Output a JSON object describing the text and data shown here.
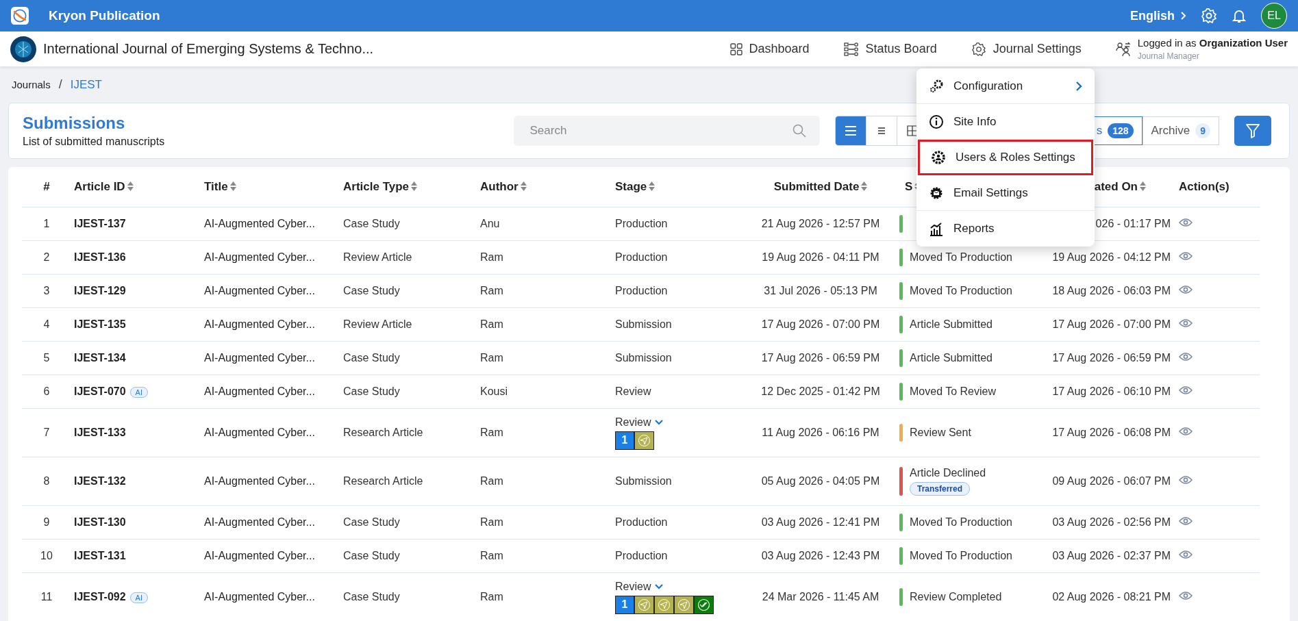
{
  "app_bar": {
    "title": "Kryon Publication",
    "language": "English",
    "avatar": "EL"
  },
  "journal_bar": {
    "title": "International Journal of Emerging Systems & Techno...",
    "nav": [
      "Dashboard",
      "Status Board",
      "Journal Settings"
    ],
    "user": "Logged in as **Organization User**",
    "role": "Journal Manager"
  },
  "breadcrumb": [
    {
      "label": "Journals",
      "selected": false
    },
    {
      "separator": "/",
      "label": "IJEST",
      "selected": true
    }
  ],
  "header": {
    "title": "Submissions",
    "subtitle": "List of submitted manuscripts",
    "search": {
      "placeholder": "Search"
    },
    "views": [
      {
        "selected": true
      },
      {
        "selected": false
      },
      {
        "selected": false
      }
    ],
    "tabs": [
      {
        "label": "s",
        "count": "128",
        "selected": true
      },
      {
        "label": "Archive",
        "count": "9",
        "selected": false
      }
    ]
  },
  "menu": [
    {
      "label": "Configuration",
      "submenu": true,
      "highlighted": false
    },
    {
      "label": "Site Info",
      "submenu": false,
      "highlighted": false
    },
    {
      "label": "Users & Roles Settings",
      "submenu": false,
      "highlighted": true
    },
    {
      "label": "Email Settings",
      "submenu": false,
      "highlighted": false
    },
    {
      "label": "Reports",
      "submenu": false,
      "highlighted": false
    }
  ],
  "table": {
    "columns": [
      "#",
      "Article ID",
      "Title",
      "Article Type",
      "Author",
      "Stage",
      "Submitted Date",
      "S",
      "ated On",
      "Action(s)"
    ],
    "rows": [
      {
        "n": "1",
        "id": "IJEST-137",
        "title": "AI-Augmented Cyber...",
        "type": "Case Study",
        "author": "Anu",
        "stage": {
          "kind": "text",
          "label": "Production"
        },
        "submitted": "21 Aug 2026 - 12:57 PM",
        "color": "#5cb85c",
        "updated": "026 - 01:17 PM"
      },
      {
        "n": "2",
        "id": "IJEST-136",
        "title": "AI-Augmented Cyber...",
        "type": "Review Article",
        "author": "Ram",
        "stage": {
          "kind": "text",
          "label": "Production"
        },
        "submitted": "19 Aug 2026 - 04:11 PM",
        "status": "Moved To Production",
        "color": "#5cb85c",
        "updated": "19 Aug 2026 - 04:12 PM"
      },
      {
        "n": "3",
        "id": "IJEST-129",
        "title": "AI-Augmented Cyber...",
        "type": "Case Study",
        "author": "Ram",
        "stage": {
          "kind": "text",
          "label": "Production"
        },
        "submitted": "31 Jul 2026 - 05:13 PM",
        "status": "Moved To Production",
        "color": "#5cb85c",
        "updated": "18 Aug 2026 - 06:03 PM"
      },
      {
        "n": "4",
        "id": "IJEST-135",
        "title": "AI-Augmented Cyber...",
        "type": "Review Article",
        "author": "Ram",
        "stage": {
          "kind": "text",
          "label": "Submission"
        },
        "submitted": "17 Aug 2026 - 07:00 PM",
        "status": "Article Submitted",
        "color": "#5cb85c",
        "updated": "17 Aug 2026 - 07:00 PM"
      },
      {
        "n": "5",
        "id": "IJEST-134",
        "title": "AI-Augmented Cyber...",
        "type": "Case Study",
        "author": "Ram",
        "stage": {
          "kind": "text",
          "label": "Submission"
        },
        "submitted": "17 Aug 2026 - 06:59 PM",
        "status": "Article Submitted",
        "color": "#5cb85c",
        "updated": "17 Aug 2026 - 06:59 PM"
      },
      {
        "n": "6",
        "id": "IJEST-070",
        "ai": "AI",
        "title": "AI-Augmented Cyber...",
        "type": "Case Study",
        "author": "Kousi",
        "stage": {
          "kind": "text",
          "label": "Review"
        },
        "submitted": "12 Dec 2025 - 01:42 PM",
        "status": "Moved To Review",
        "color": "#5cb85c",
        "updated": "17 Aug 2026 - 06:10 PM"
      },
      {
        "n": "7",
        "id": "IJEST-133",
        "title": "AI-Augmented Cyber...",
        "type": "Research Article",
        "author": "Ram",
        "stage": {
          "kind": "review",
          "label": "Review",
          "steps": [
            {
              "kind": "number",
              "label": "1"
            },
            {
              "kind": "sent"
            }
          ]
        },
        "submitted": "11 Aug 2026 - 06:16 PM",
        "status": "Review Sent",
        "color": "#f0ad4e",
        "updated": "17 Aug 2026 - 06:08 PM"
      },
      {
        "n": "8",
        "id": "IJEST-132",
        "title": "AI-Augmented Cyber...",
        "type": "Research Article",
        "author": "Ram",
        "stage": {
          "kind": "text",
          "label": "Submission"
        },
        "submitted": "05 Aug 2026 - 04:05 PM",
        "status": "Article Declined",
        "badge": "Transferred",
        "color": "#d9534f",
        "updated": "09 Aug 2026 - 06:07 PM"
      },
      {
        "n": "9",
        "id": "IJEST-130",
        "title": "AI-Augmented Cyber...",
        "type": "Case Study",
        "author": "Ram",
        "stage": {
          "kind": "text",
          "label": "Production"
        },
        "submitted": "03 Aug 2026 - 12:41 PM",
        "status": "Moved To Production",
        "color": "#5cb85c",
        "updated": "03 Aug 2026 - 02:56 PM"
      },
      {
        "n": "10",
        "id": "IJEST-131",
        "title": "AI-Augmented Cyber...",
        "type": "Case Study",
        "author": "Ram",
        "stage": {
          "kind": "text",
          "label": "Production"
        },
        "submitted": "03 Aug 2026 - 12:43 PM",
        "status": "Moved To Production",
        "color": "#5cb85c",
        "updated": "03 Aug 2026 - 02:37 PM"
      },
      {
        "n": "11",
        "id": "IJEST-092",
        "ai": "AI",
        "title": "AI-Augmented Cyber...",
        "type": "Case Study",
        "author": "Ram",
        "stage": {
          "kind": "review",
          "label": "Review",
          "steps": [
            {
              "kind": "number",
              "label": "1"
            },
            {
              "kind": "sent"
            },
            {
              "kind": "sent"
            },
            {
              "kind": "sent"
            },
            {
              "kind": "done"
            }
          ]
        },
        "submitted": "24 Mar 2026 - 11:45 AM",
        "status": "Review Completed",
        "color": "#5cb85c",
        "updated": "02 Aug 2026 - 08:21 PM"
      }
    ]
  }
}
